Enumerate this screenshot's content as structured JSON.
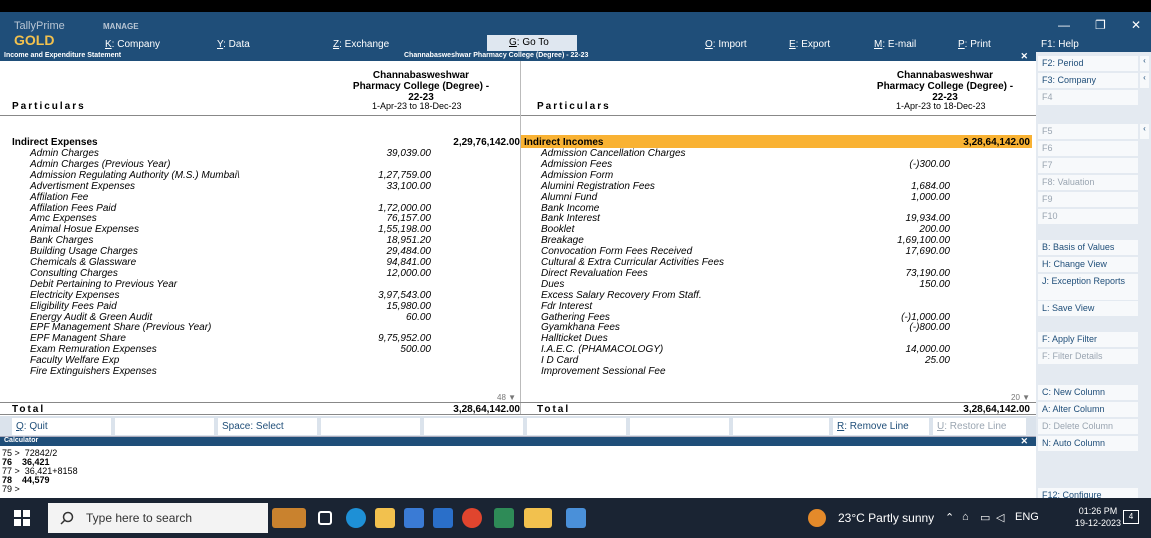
{
  "app": {
    "brand_line1": "TallyPrime",
    "brand_line2": "GOLD",
    "manage_label": "MANAGE"
  },
  "menu": {
    "company": {
      "key": "K",
      "label": ": Company"
    },
    "data": {
      "key": "Y",
      "label": ": Data"
    },
    "exchange": {
      "key": "Z",
      "label": ": Exchange"
    },
    "goto": {
      "key": "G",
      "label": ": Go To"
    },
    "import": {
      "key": "O",
      "label": ": Import"
    },
    "export": {
      "key": "E",
      "label": ": Export"
    },
    "email": {
      "key": "M",
      "label": ": E-mail"
    },
    "print": {
      "key": "P",
      "label": ": Print"
    },
    "help": {
      "label": "F1: Help"
    }
  },
  "window_controls": {
    "minimize": "—",
    "maximize": "❐",
    "close": "✕"
  },
  "subbar": {
    "left": "Income and Expenditure Statement",
    "center": "Channabasweshwar Pharmacy College (Degree) - 22-23",
    "close": "✕"
  },
  "report": {
    "left": {
      "company_line1": "Channabasweshwar",
      "company_line2": "Pharmacy College (Degree) -",
      "company_line3": "22-23",
      "period": "1-Apr-23 to 18-Dec-23",
      "particulars": "Particulars",
      "group": "Indirect Expenses",
      "group_amount": "2,29,76,142.00",
      "more": "48 ▼",
      "rows": [
        {
          "name": "Admin Charges",
          "amount": "39,039.00"
        },
        {
          "name": "Admin Charges (Previous Year)",
          "amount": ""
        },
        {
          "name": "Admission Regulating Authority (M.S.) Mumbai\\",
          "amount": "1,27,759.00"
        },
        {
          "name": "Advertisment Expenses",
          "amount": "33,100.00"
        },
        {
          "name": "Affilation Fee",
          "amount": ""
        },
        {
          "name": "Affilation Fees Paid",
          "amount": "1,72,000.00"
        },
        {
          "name": "Amc Expenses",
          "amount": "76,157.00"
        },
        {
          "name": "Animal Hosue Expenses",
          "amount": "1,55,198.00"
        },
        {
          "name": "Bank Charges",
          "amount": "18,951.20"
        },
        {
          "name": "Building Usage Charges",
          "amount": "29,484.00"
        },
        {
          "name": "Chemicals & Glassware",
          "amount": "94,841.00"
        },
        {
          "name": "Consulting Charges",
          "amount": "12,000.00"
        },
        {
          "name": "Debit Pertaining to Previous Year",
          "amount": ""
        },
        {
          "name": "Electricity  Expenses",
          "amount": "3,97,543.00"
        },
        {
          "name": "Eligibility Fees Paid",
          "amount": "15,980.00"
        },
        {
          "name": "Energy Audit & Green Audit",
          "amount": "60.00"
        },
        {
          "name": "EPF Management Share (Previous Year)",
          "amount": ""
        },
        {
          "name": "EPF Managent Share",
          "amount": "9,75,952.00"
        },
        {
          "name": "Exam Remuration Expenses",
          "amount": "500.00"
        },
        {
          "name": "Faculty Welfare Exp",
          "amount": ""
        },
        {
          "name": "Fire Extinguishers Expenses",
          "amount": ""
        }
      ],
      "total_label": "Total",
      "total_amount": "3,28,64,142.00"
    },
    "right": {
      "company_line1": "Channabasweshwar",
      "company_line2": "Pharmacy College (Degree) -",
      "company_line3": "22-23",
      "period": "1-Apr-23 to 18-Dec-23",
      "particulars": "Particulars",
      "group": "Indirect Incomes",
      "group_amount": "3,28,64,142.00",
      "more": "20 ▼",
      "rows": [
        {
          "name": "Admission Cancellation Charges",
          "amount": ""
        },
        {
          "name": "Admission Fees",
          "amount": "(-)300.00"
        },
        {
          "name": "Admission Form",
          "amount": ""
        },
        {
          "name": "Alumini Registration Fees",
          "amount": "1,684.00"
        },
        {
          "name": "Alumni Fund",
          "amount": "1,000.00"
        },
        {
          "name": "Bank Income",
          "amount": ""
        },
        {
          "name": "Bank Interest",
          "amount": "19,934.00"
        },
        {
          "name": "Booklet",
          "amount": "200.00"
        },
        {
          "name": "Breakage",
          "amount": "1,69,100.00"
        },
        {
          "name": "Convocation Form Fees Received",
          "amount": "17,690.00"
        },
        {
          "name": "Cultural & Extra Curricular Activities Fees",
          "amount": ""
        },
        {
          "name": "Direct Revaluation Fees",
          "amount": "73,190.00"
        },
        {
          "name": "Dues",
          "amount": "150.00"
        },
        {
          "name": "Excess Salary Recovery From Staff.",
          "amount": ""
        },
        {
          "name": "Fdr Interest",
          "amount": ""
        },
        {
          "name": "Gathering Fees",
          "amount": "(-)1,000.00"
        },
        {
          "name": "Gyamkhana Fees",
          "amount": "(-)800.00"
        },
        {
          "name": "Hallticket Dues",
          "amount": ""
        },
        {
          "name": "I.A.E.C. (PHAMACOLOGY)",
          "amount": "14,000.00"
        },
        {
          "name": "I D Card",
          "amount": "25.00"
        },
        {
          "name": "Improvement Sessional Fee",
          "amount": ""
        }
      ],
      "total_label": "Total",
      "total_amount": "3,28,64,142.00"
    }
  },
  "buttons": {
    "quit_key": "Q",
    "quit_label": ": Quit",
    "select_key": "Space",
    "select_label": ": Select",
    "remove_key": "R",
    "remove_label": ": Remove Line",
    "restore_key": "U",
    "restore_label": ": Restore Line"
  },
  "calculator": {
    "header": "Calculator",
    "close": "✕",
    "lines": [
      {
        "text": "75 >  72842/2",
        "bold": false
      },
      {
        "text": "76    36,421",
        "bold": true
      },
      {
        "text": "77 >  36,421+8158",
        "bold": false
      },
      {
        "text": "78    44,579",
        "bold": true
      },
      {
        "text": "79 >",
        "bold": false
      }
    ]
  },
  "sidebar": [
    {
      "label": "F2: Period",
      "state": "on",
      "arrow": "‹"
    },
    {
      "label": "F3: Company",
      "state": "on",
      "arrow": "‹"
    },
    {
      "label": "F4",
      "state": "dim",
      "arrow": ""
    },
    {
      "label": "F5",
      "state": "dim",
      "arrow": "‹"
    },
    {
      "label": "F6",
      "state": "dim",
      "arrow": ""
    },
    {
      "label": "F7",
      "state": "dim",
      "arrow": ""
    },
    {
      "label": "F8: Valuation",
      "state": "dim",
      "arrow": ""
    },
    {
      "label": "F9",
      "state": "dim",
      "arrow": ""
    },
    {
      "label": "F10",
      "state": "dim",
      "arrow": ""
    },
    {
      "label": "B: Basis of Values",
      "state": "on",
      "arrow": ""
    },
    {
      "label": "H: Change View",
      "state": "on",
      "arrow": ""
    },
    {
      "label": "J: Exception Reports",
      "state": "on",
      "arrow": ""
    },
    {
      "label": "L: Save View",
      "state": "on",
      "arrow": ""
    },
    {
      "label": "F: Apply Filter",
      "state": "on",
      "arrow": ""
    },
    {
      "label": "F: Filter Details",
      "state": "dim",
      "arrow": ""
    },
    {
      "label": "C: New Column",
      "state": "on",
      "arrow": ""
    },
    {
      "label": "A: Alter Column",
      "state": "on",
      "arrow": ""
    },
    {
      "label": "D: Delete Column",
      "state": "dim",
      "arrow": ""
    },
    {
      "label": "N: Auto Column",
      "state": "on",
      "arrow": ""
    },
    {
      "label": "F12: Configure",
      "state": "on",
      "arrow": ""
    }
  ],
  "taskbar": {
    "search_placeholder": "Type here to search",
    "weather": "23°C  Partly sunny",
    "lang": "ENG",
    "time": "01:26 PM",
    "date": "19-12-2023",
    "notifications": "4"
  },
  "colors": {
    "brand": "#1f4e79",
    "highlight": "#f9b233",
    "gold": "#f2c14e"
  }
}
